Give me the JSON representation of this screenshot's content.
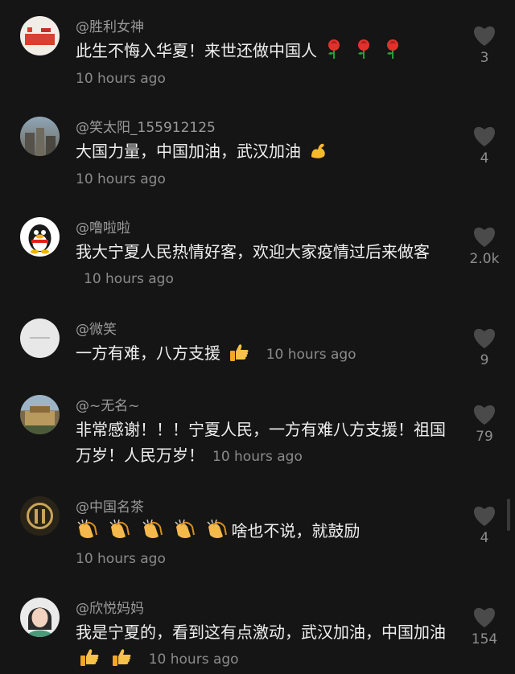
{
  "comments": [
    {
      "username": "@胜利女神",
      "text": "此生不悔入华夏！来世还做中国人",
      "time": "10 hours ago",
      "likes": "3",
      "avatar": "flag-badge"
    },
    {
      "username": "@笑太阳_155912125",
      "text": "大国力量，中国加油，武汉加油",
      "time": "10 hours ago",
      "likes": "4",
      "avatar": "building-photo"
    },
    {
      "username": "@噜啦啦",
      "text": "我大宁夏人民热情好客，欢迎大家疫情过后来做客",
      "time": "10 hours ago",
      "likes": "2.0k",
      "avatar": "penguin"
    },
    {
      "username": "@微笑",
      "text": "一方有难，八方支援",
      "time": "10 hours ago",
      "likes": "9",
      "avatar": "white-circle"
    },
    {
      "username": "@~无名~",
      "text": "非常感谢！！！宁夏人民，一方有难八方支援！祖国万岁！人民万岁！",
      "time": "10 hours ago",
      "likes": "79",
      "avatar": "palace-photo"
    },
    {
      "username": "@中国名茶",
      "text": "啥也不说，就鼓励",
      "time": "10 hours ago",
      "likes": "4",
      "avatar": "tea-photo"
    },
    {
      "username": "@欣悦妈妈",
      "text": "我是宁夏的，看到这有点激动，武汉加油，中国加油",
      "time": "10 hours ago",
      "likes": "154",
      "avatar": "woman-photo"
    }
  ],
  "colors": {
    "background": "#151515",
    "username": "#9a9a9a",
    "text": "#efefef",
    "heart": "#4a4a4a"
  }
}
